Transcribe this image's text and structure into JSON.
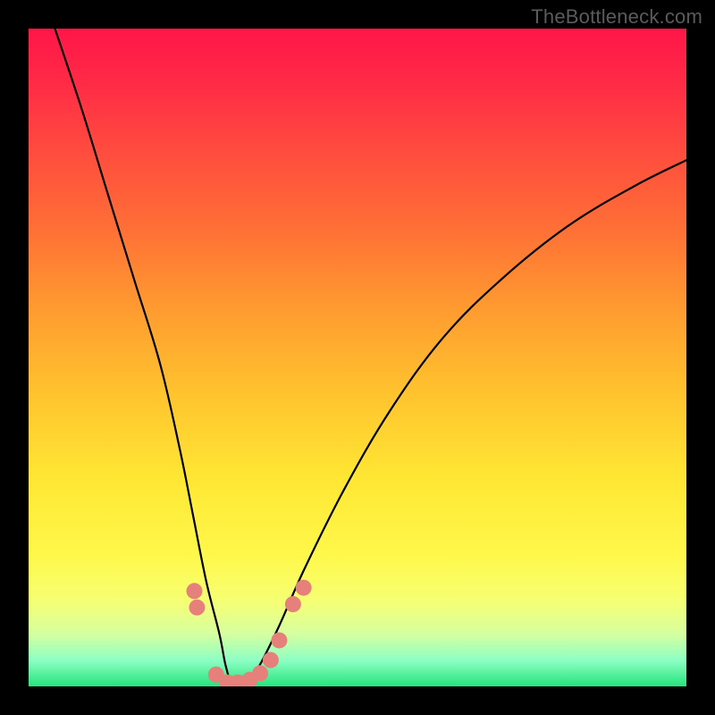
{
  "watermark": "TheBottleneck.com",
  "chart_data": {
    "type": "line",
    "title": "",
    "xlabel": "",
    "ylabel": "",
    "xlim": [
      0,
      100
    ],
    "ylim": [
      0,
      100
    ],
    "series": [
      {
        "name": "bottleneck-curve",
        "x": [
          4,
          8,
          12,
          16,
          20,
          23,
          25,
          27,
          29,
          30,
          31,
          33,
          35,
          38,
          42,
          48,
          55,
          63,
          72,
          82,
          92,
          100
        ],
        "y": [
          100,
          88,
          75,
          62,
          49,
          36,
          26,
          16,
          8,
          3,
          0.5,
          0.5,
          3,
          9,
          18,
          30,
          42,
          53,
          62,
          70,
          76,
          80
        ]
      }
    ],
    "markers": {
      "name": "highlight-dots",
      "color": "#e5807a",
      "points": [
        {
          "x": 25.2,
          "y": 14.5
        },
        {
          "x": 25.6,
          "y": 12.0
        },
        {
          "x": 28.5,
          "y": 1.8
        },
        {
          "x": 30.2,
          "y": 0.6
        },
        {
          "x": 31.8,
          "y": 0.6
        },
        {
          "x": 33.6,
          "y": 1.0
        },
        {
          "x": 35.2,
          "y": 2.0
        },
        {
          "x": 36.8,
          "y": 4.0
        },
        {
          "x": 38.1,
          "y": 7.0
        },
        {
          "x": 40.2,
          "y": 12.5
        },
        {
          "x": 41.8,
          "y": 15.0
        }
      ]
    }
  }
}
